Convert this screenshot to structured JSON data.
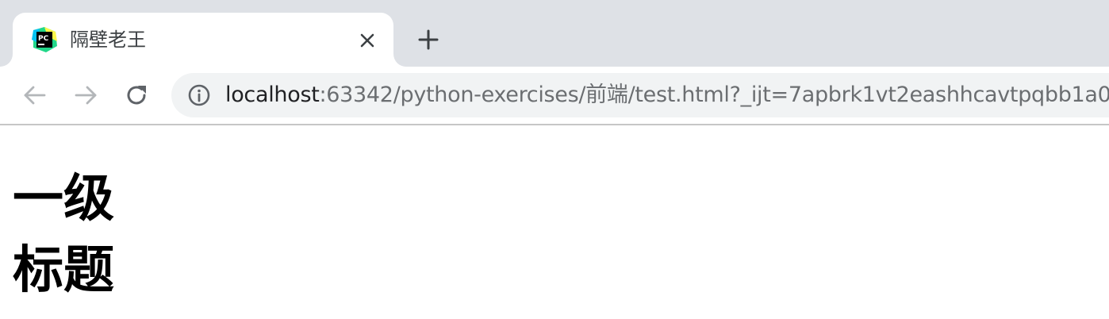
{
  "tab": {
    "favicon": "pycharm-logo-icon",
    "title": "隔壁老王",
    "close_icon": "close-icon"
  },
  "new_tab_icon": "plus-icon",
  "toolbar": {
    "back_icon": "arrow-left-icon",
    "forward_icon": "arrow-right-icon",
    "reload_icon": "reload-icon",
    "info_icon": "info-icon"
  },
  "address_bar": {
    "host": "localhost",
    "rest": ":63342/python-exercises/前端/test.html?_ijt=7apbrk1vt2eashhcavtpqbb1a0"
  },
  "page": {
    "heading": "一级标题"
  },
  "colors": {
    "tabstrip_bg": "#dee1e6",
    "omnibox_bg": "#f1f3f4",
    "url_host": "#202124",
    "url_rest": "#6b6e71"
  }
}
